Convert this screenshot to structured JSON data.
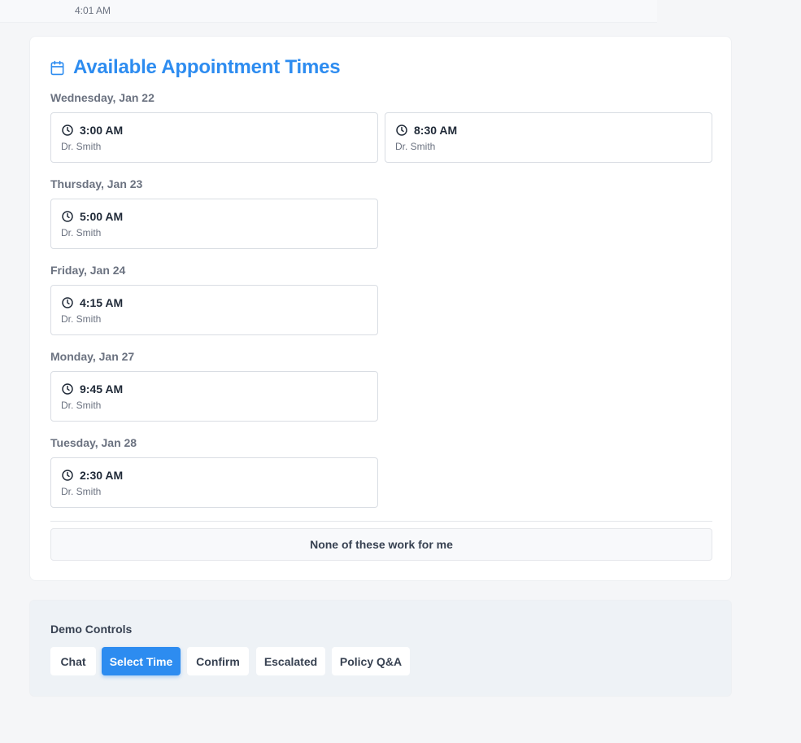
{
  "message": {
    "timestamp": "4:01 AM"
  },
  "appointments": {
    "title": "Available Appointment Times",
    "icon": "calendar-icon",
    "accent_color": "#2d8cf0",
    "days": [
      {
        "label": "Wednesday, Jan 22",
        "slots": [
          {
            "time": "3:00 AM",
            "doctor": "Dr. Smith"
          },
          {
            "time": "8:30 AM",
            "doctor": "Dr. Smith"
          }
        ]
      },
      {
        "label": "Thursday, Jan 23",
        "slots": [
          {
            "time": "5:00 AM",
            "doctor": "Dr. Smith"
          }
        ]
      },
      {
        "label": "Friday, Jan 24",
        "slots": [
          {
            "time": "4:15 AM",
            "doctor": "Dr. Smith"
          }
        ]
      },
      {
        "label": "Monday, Jan 27",
        "slots": [
          {
            "time": "9:45 AM",
            "doctor": "Dr. Smith"
          }
        ]
      },
      {
        "label": "Tuesday, Jan 28",
        "slots": [
          {
            "time": "2:30 AM",
            "doctor": "Dr. Smith"
          }
        ]
      }
    ],
    "none_label": "None of these work for me"
  },
  "demo_controls": {
    "title": "Demo Controls",
    "buttons": [
      {
        "label": "Chat"
      },
      {
        "label": "Select Time",
        "active": true
      },
      {
        "label": "Confirm"
      },
      {
        "label": "Escalated"
      },
      {
        "label": "Policy Q&A"
      }
    ]
  }
}
